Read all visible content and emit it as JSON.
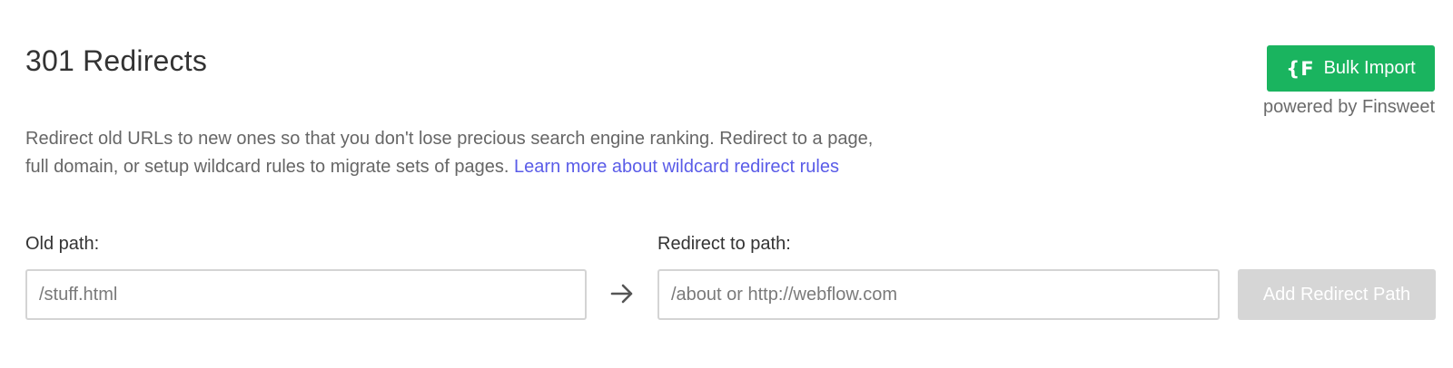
{
  "header": {
    "title": "301 Redirects"
  },
  "bulk_import": {
    "icon_text": "{F",
    "label": "Bulk Import",
    "powered_by": "powered by Finsweet",
    "color": "#1ab45f"
  },
  "description": {
    "text": "Redirect old URLs to new ones so that you don't lose precious search engine ranking. Redirect to a page, full domain, or setup wildcard rules to migrate sets of pages. ",
    "link_text": "Learn more about wildcard redirect rules",
    "link_color": "#5a5ce8"
  },
  "form": {
    "old_path_label": "Old path:",
    "old_path_placeholder": "/stuff.html",
    "old_path_value": "",
    "redirect_label": "Redirect to path:",
    "redirect_placeholder": "/about or http://webflow.com",
    "redirect_value": "",
    "arrow_icon": "arrow-right-icon",
    "add_button_label": "Add Redirect Path"
  }
}
